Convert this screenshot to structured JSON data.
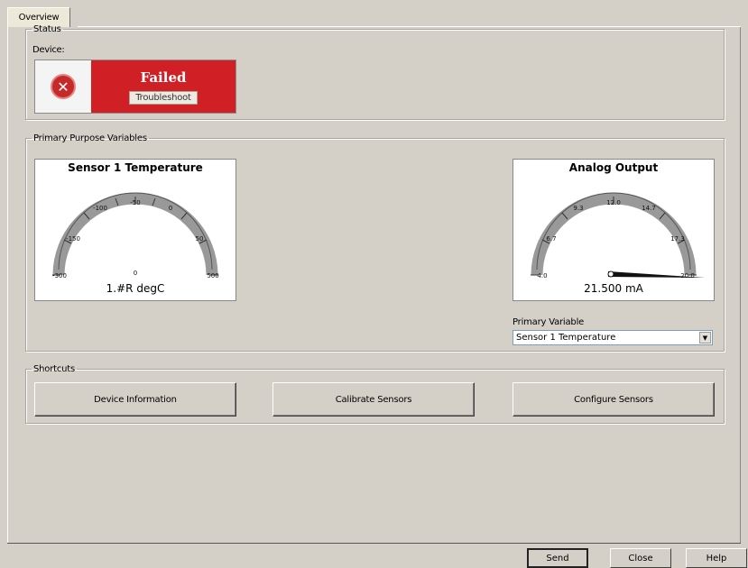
{
  "tabs": [
    {
      "label": "Overview"
    }
  ],
  "status": {
    "legend": "Status",
    "device_label": "Device:",
    "state_text": "Failed",
    "troubleshoot_label": "Troubleshoot",
    "state_color": "#d01f25"
  },
  "ppv": {
    "legend": "Primary Purpose Variables",
    "gauges": [
      {
        "title": "Sensor 1 Temperature",
        "value_text": "1.#R degC",
        "tick_labels": [
          "-300",
          "-150",
          "-100",
          "-50",
          "0",
          "50",
          "100",
          "0",
          "500"
        ]
      },
      {
        "title": "Analog Output",
        "value_text": "21.500 mA",
        "tick_labels": [
          "4.0",
          "6.7",
          "9.3",
          "12.0",
          "14.7",
          "17.3",
          "20.0"
        ]
      }
    ],
    "primary_variable_label": "Primary Variable",
    "primary_variable_value": "Sensor 1 Temperature"
  },
  "shortcuts": {
    "legend": "Shortcuts",
    "buttons": [
      "Device Information",
      "Calibrate Sensors",
      "Configure Sensors"
    ]
  },
  "footer": {
    "send_label": "Send",
    "close_label": "Close",
    "help_label": "Help"
  }
}
